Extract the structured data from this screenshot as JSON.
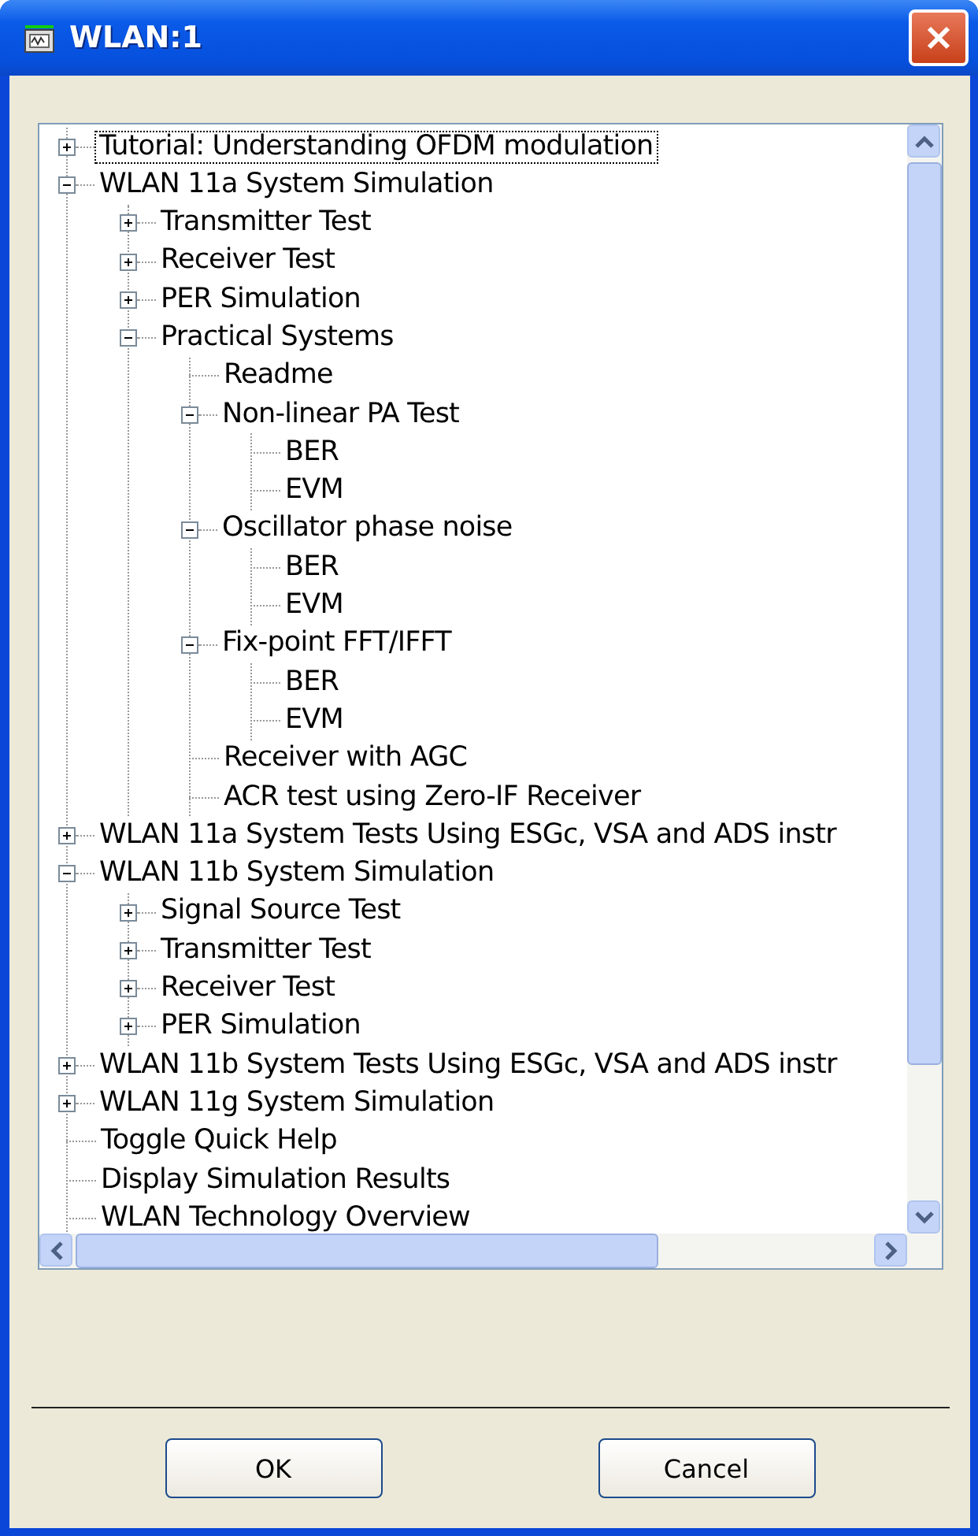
{
  "window": {
    "title": "WLAN:1"
  },
  "tree": [
    {
      "label": "Tutorial: Understanding OFDM modulation",
      "expanded": false,
      "selected": true
    },
    {
      "label": "WLAN 11a System Simulation",
      "expanded": true,
      "selected": false,
      "children": [
        {
          "label": "Transmitter Test",
          "expanded": false,
          "selected": false
        },
        {
          "label": "Receiver Test",
          "expanded": false,
          "selected": false
        },
        {
          "label": "PER Simulation",
          "expanded": false,
          "selected": false
        },
        {
          "label": "Practical Systems",
          "expanded": true,
          "selected": false,
          "children": [
            {
              "label": "Readme",
              "selected": false
            },
            {
              "label": "Non-linear PA Test",
              "expanded": true,
              "selected": false,
              "children": [
                {
                  "label": "BER",
                  "selected": false
                },
                {
                  "label": "EVM",
                  "selected": false
                }
              ]
            },
            {
              "label": "Oscillator phase noise",
              "expanded": true,
              "selected": false,
              "children": [
                {
                  "label": "BER",
                  "selected": false
                },
                {
                  "label": "EVM",
                  "selected": false
                }
              ]
            },
            {
              "label": "Fix-point FFT/IFFT",
              "expanded": true,
              "selected": false,
              "children": [
                {
                  "label": "BER",
                  "selected": false
                },
                {
                  "label": "EVM",
                  "selected": false
                }
              ]
            },
            {
              "label": "Receiver with AGC",
              "selected": false
            },
            {
              "label": "ACR test using Zero-IF Receiver",
              "selected": false
            }
          ]
        }
      ]
    },
    {
      "label": "WLAN 11a System Tests Using ESGc, VSA and ADS instr",
      "expanded": false,
      "selected": false
    },
    {
      "label": "WLAN 11b System Simulation",
      "expanded": true,
      "selected": false,
      "children": [
        {
          "label": "Signal Source Test",
          "expanded": false,
          "selected": false
        },
        {
          "label": "Transmitter Test",
          "expanded": false,
          "selected": false
        },
        {
          "label": "Receiver Test",
          "expanded": false,
          "selected": false
        },
        {
          "label": "PER Simulation",
          "expanded": false,
          "selected": false
        }
      ]
    },
    {
      "label": "WLAN 11b System Tests Using ESGc, VSA and ADS instr",
      "expanded": false,
      "selected": false
    },
    {
      "label": "WLAN 11g System Simulation",
      "expanded": false,
      "selected": false
    },
    {
      "label": "Toggle Quick Help",
      "selected": false
    },
    {
      "label": "Display Simulation Results",
      "selected": false
    },
    {
      "label": "WLAN Technology Overview",
      "selected": false
    }
  ],
  "buttons": [
    "OK",
    "Cancel"
  ]
}
